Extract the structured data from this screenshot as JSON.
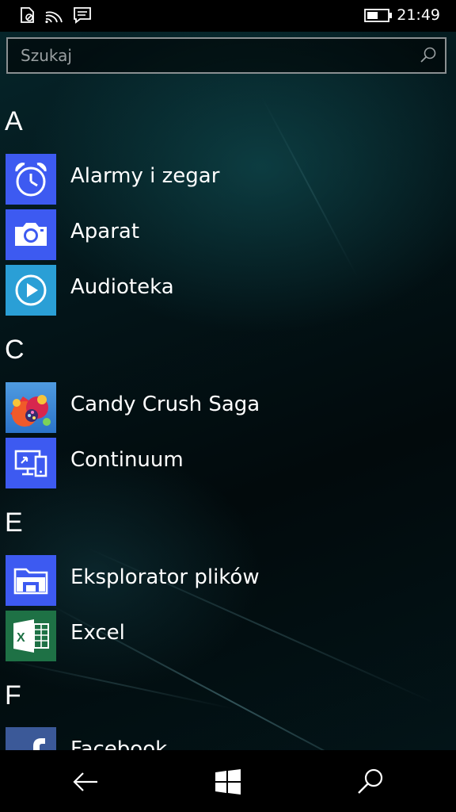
{
  "status_bar": {
    "time": "21:49",
    "icons": [
      "sim-no-signal-icon",
      "wifi-icon",
      "notifications-icon",
      "battery-icon"
    ]
  },
  "search": {
    "placeholder": "Szukaj",
    "icon": "search-icon"
  },
  "sections": [
    {
      "letter": "A",
      "apps": [
        {
          "label": "Alarmy i zegar",
          "icon": "alarm-clock-icon",
          "tile_color": "#3d5af1"
        },
        {
          "label": "Aparat",
          "icon": "camera-icon",
          "tile_color": "#3d5af1"
        },
        {
          "label": "Audioteka",
          "icon": "play-circle-icon",
          "tile_color": "#2a9fd6"
        }
      ]
    },
    {
      "letter": "C",
      "apps": [
        {
          "label": "Candy Crush Saga",
          "icon": "candy-icon",
          "tile_color": "#2b73c9"
        },
        {
          "label": "Continuum",
          "icon": "continuum-devices-icon",
          "tile_color": "#3d5af1"
        }
      ]
    },
    {
      "letter": "E",
      "apps": [
        {
          "label": "Eksplorator plików",
          "icon": "folder-icon",
          "tile_color": "#3d5af1"
        },
        {
          "label": "Excel",
          "icon": "excel-icon",
          "tile_color": "#1e7145"
        }
      ]
    },
    {
      "letter": "F",
      "apps": [
        {
          "label": "Facebook",
          "icon": "facebook-icon",
          "tile_color": "#3b5998"
        }
      ]
    }
  ],
  "nav_bar": {
    "buttons": [
      "back-arrow-icon",
      "windows-start-icon",
      "search-icon"
    ]
  }
}
